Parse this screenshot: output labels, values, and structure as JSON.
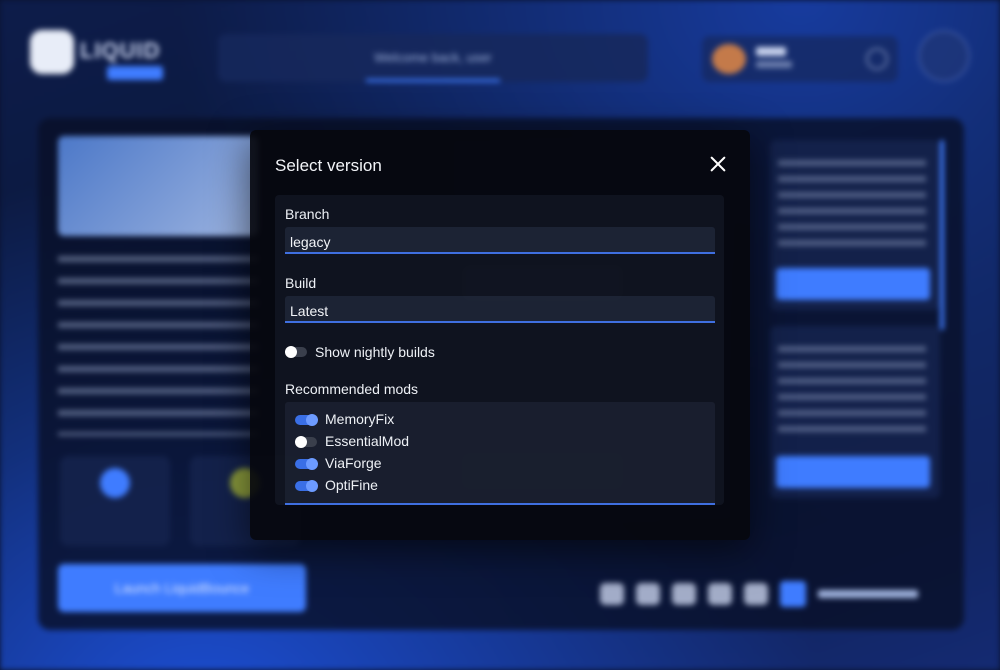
{
  "background": {
    "logo_text": "LIQUID",
    "welcome_text": "Welcome back, user",
    "launch_button_label": "Launch LiquidBounce"
  },
  "modal": {
    "title": "Select version",
    "branch": {
      "label": "Branch",
      "value": "legacy"
    },
    "build": {
      "label": "Build",
      "value": "Latest"
    },
    "nightly": {
      "label": "Show nightly builds",
      "enabled": false
    },
    "recommended_mods": {
      "label": "Recommended mods",
      "items": [
        {
          "name": "MemoryFix",
          "enabled": true
        },
        {
          "name": "EssentialMod",
          "enabled": false
        },
        {
          "name": "ViaForge",
          "enabled": true
        },
        {
          "name": "OptiFine",
          "enabled": true
        }
      ]
    }
  },
  "colors": {
    "accent": "#3f7cff",
    "modal_bg": "#06080e",
    "toggle_on": "#3a6fe6",
    "toggle_off": "#3a3f4c"
  }
}
